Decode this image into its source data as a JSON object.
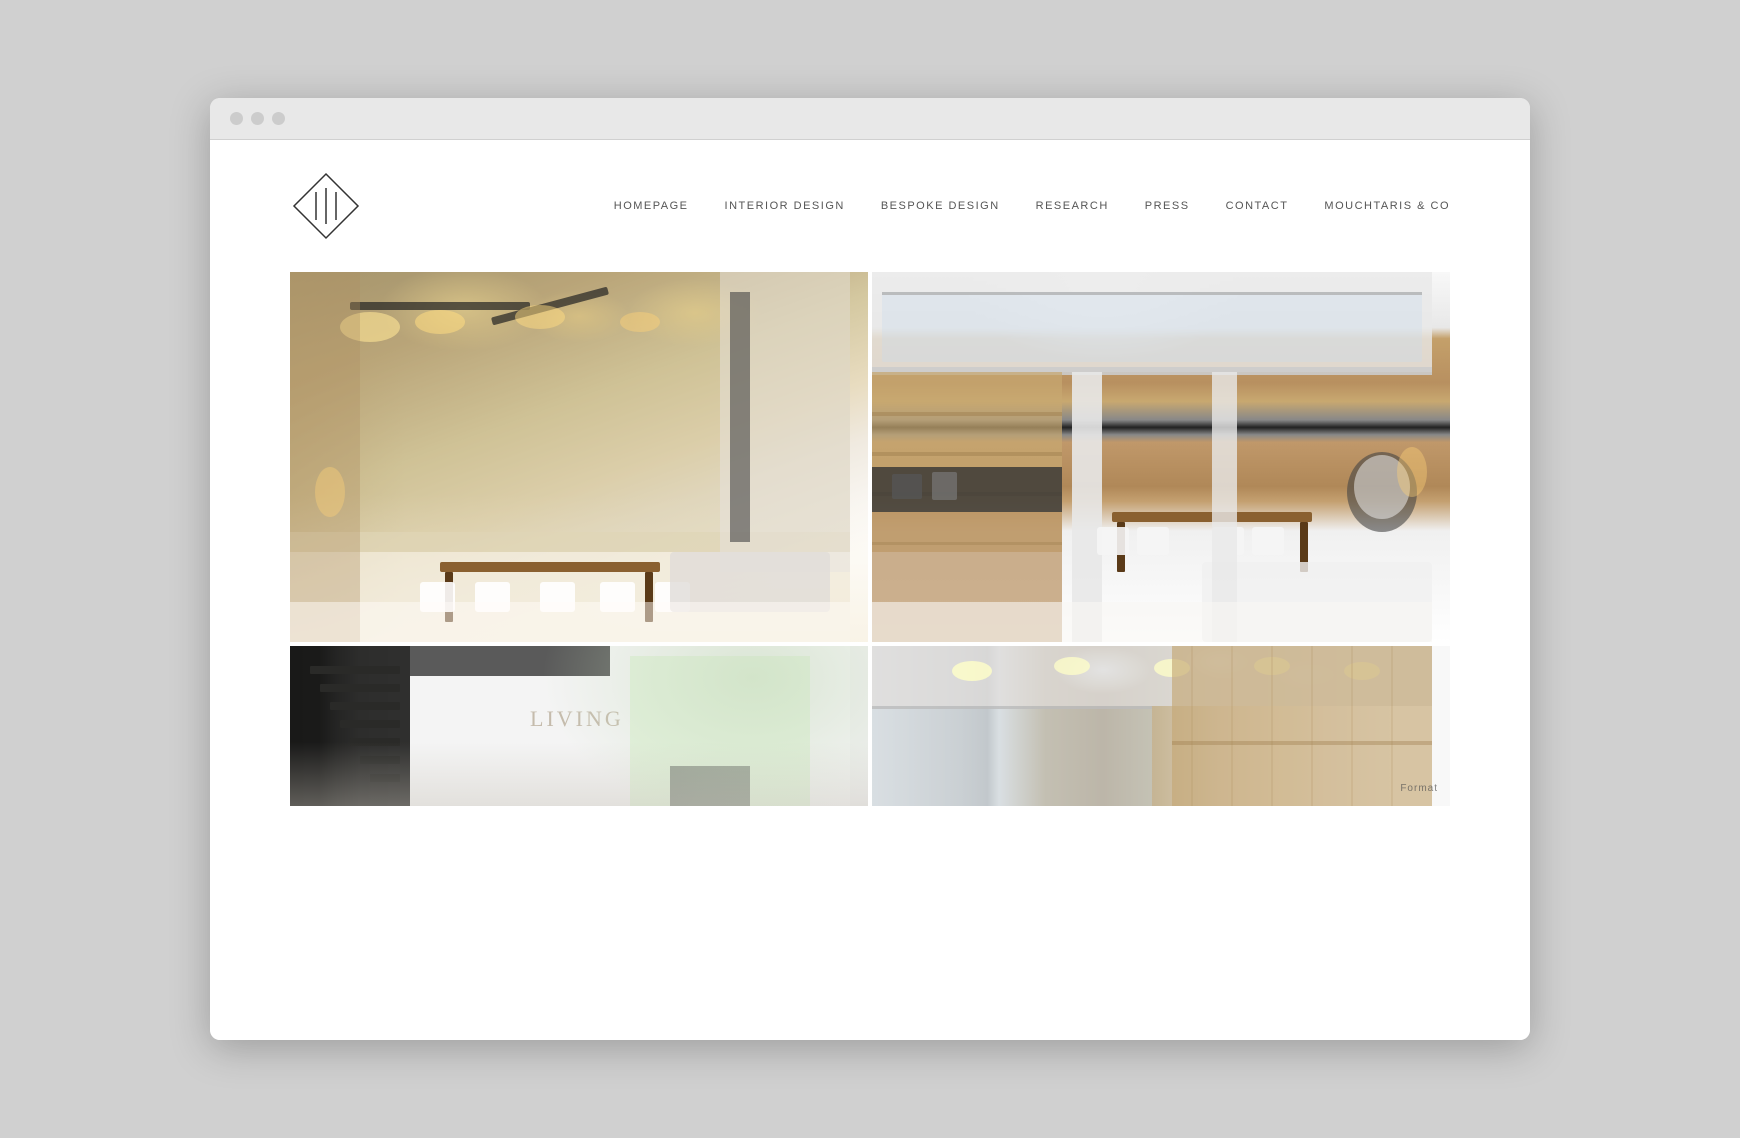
{
  "browser": {
    "dots": [
      "dot1",
      "dot2",
      "dot3"
    ]
  },
  "header": {
    "logo_text": "111"
  },
  "nav": {
    "items": [
      {
        "id": "homepage",
        "label": "HOMEPAGE"
      },
      {
        "id": "interior-design",
        "label": "INTERIOR DESIGN"
      },
      {
        "id": "bespoke-design",
        "label": "BESPOKE DESIGN"
      },
      {
        "id": "research",
        "label": "RESEARCH"
      },
      {
        "id": "press",
        "label": "PRESS"
      },
      {
        "id": "contact",
        "label": "CONTACT"
      },
      {
        "id": "mouchtaris-co",
        "label": "MOUCHTARIS & CO"
      }
    ]
  },
  "gallery": {
    "photos": [
      {
        "id": "photo-1",
        "alt": "Interior dining room with pendant lights and wooden table",
        "position": "top-left"
      },
      {
        "id": "photo-2",
        "alt": "Kitchen and living area with wooden cabinets",
        "position": "top-right"
      },
      {
        "id": "photo-3",
        "alt": "Staircase and living area interior",
        "position": "bottom-left"
      },
      {
        "id": "photo-4",
        "alt": "Glass railing and wooden panel detail",
        "position": "bottom-right"
      }
    ]
  },
  "format_label": "Format"
}
